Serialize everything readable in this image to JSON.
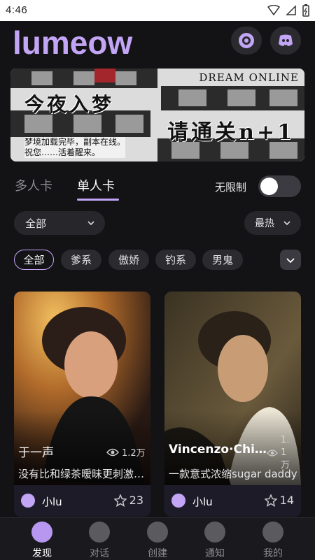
{
  "status_bar": {
    "time": "4:46"
  },
  "header": {
    "logo": "lumeow"
  },
  "banner": {
    "brand": "DREAM ONLINE",
    "headline_left": "今夜入梦",
    "headline_right": "请通关n+1",
    "sub_line1": "梦境加载完毕，副本在线。",
    "sub_line2": "祝您……活着醒来。"
  },
  "tabs": [
    {
      "label": "多人卡",
      "active": false
    },
    {
      "label": "单人卡",
      "active": true
    }
  ],
  "filter": {
    "unlimited_label": "无限制",
    "unlimited_on": false,
    "category_value": "全部",
    "sort_value": "最热"
  },
  "chips": [
    "全部",
    "爹系",
    "傲娇",
    "钓系",
    "男鬼"
  ],
  "cards": [
    {
      "name": "于一声",
      "views": "1.2万",
      "description": "没有比和绿茶暧昧更刺激的事了",
      "author": "小lu",
      "likes": "23"
    },
    {
      "name": "Vincenzo·Chi…",
      "views": "1.1万",
      "description": "一款意式浓缩sugar daddy",
      "author": "小lu",
      "likes": "14"
    }
  ],
  "nav": [
    {
      "label": "发现",
      "icon": "discover-icon",
      "active": true
    },
    {
      "label": "对话",
      "icon": "chat-icon",
      "active": false
    },
    {
      "label": "创建",
      "icon": "create-icon",
      "active": false
    },
    {
      "label": "通知",
      "icon": "bell-icon",
      "active": false
    },
    {
      "label": "我的",
      "icon": "profile-icon",
      "active": false
    }
  ],
  "colors": {
    "accent": "#c3a5f5",
    "background": "#131316",
    "card_footer": "#1e1b29"
  }
}
